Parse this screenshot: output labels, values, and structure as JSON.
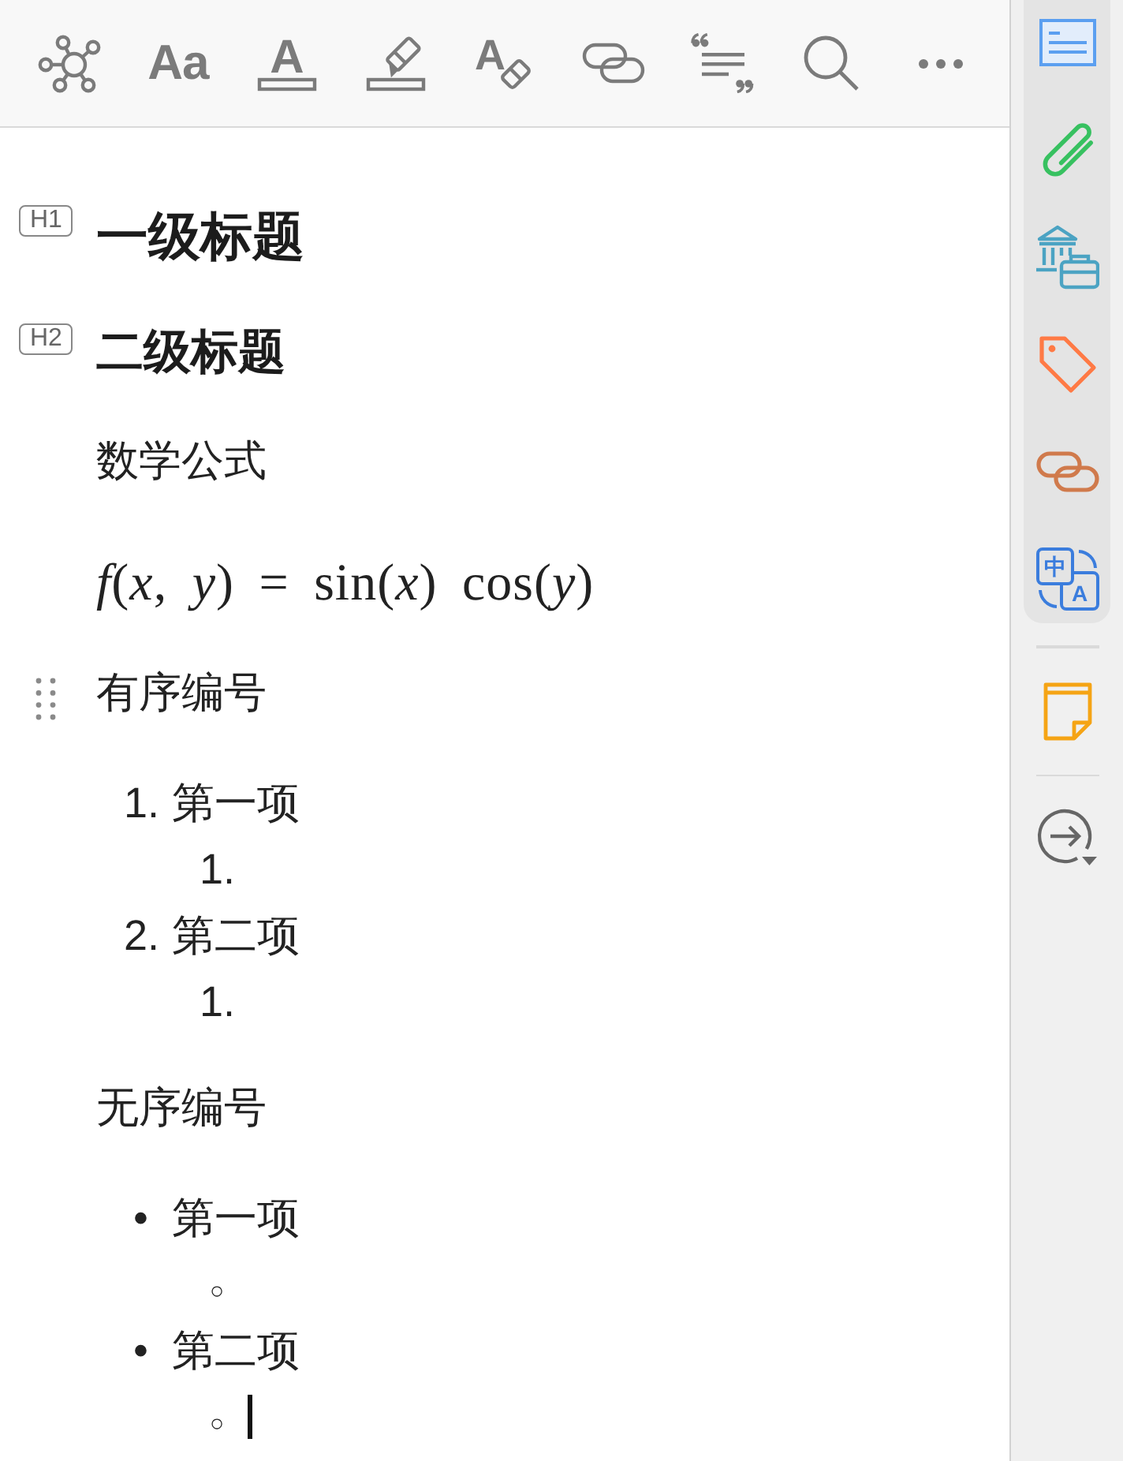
{
  "toolbar": {
    "tools": [
      {
        "kind": "graph"
      },
      {
        "kind": "font",
        "glyph": "Aa"
      },
      {
        "kind": "text-color",
        "glyph": "A"
      },
      {
        "kind": "highlight"
      },
      {
        "kind": "clear-format",
        "glyph": "A"
      },
      {
        "kind": "link"
      },
      {
        "kind": "quote"
      },
      {
        "kind": "search"
      },
      {
        "kind": "more"
      }
    ]
  },
  "document": {
    "blocks": [
      {
        "kind": "h1",
        "tag": "H1",
        "text": "一级标题"
      },
      {
        "kind": "h2",
        "tag": "H2",
        "text": "二级标题"
      },
      {
        "kind": "paragraph",
        "text": "数学公式",
        "hovered": false
      },
      {
        "kind": "formula",
        "text": "*f*(*x*, *y*) = sin(*x*) cos(*y*)"
      },
      {
        "kind": "paragraph",
        "text": "有序编号",
        "hovered": true
      },
      {
        "kind": "ordered-list",
        "items": [
          {
            "marker": "1.",
            "text": "第一项",
            "cursor": false,
            "children": [
              {
                "marker": "1.",
                "cursor": false
              }
            ]
          },
          {
            "marker": "2.",
            "text": "第二项",
            "cursor": false,
            "children": [
              {
                "marker": "1.",
                "cursor": false
              }
            ]
          }
        ]
      },
      {
        "kind": "paragraph",
        "text": "无序编号",
        "hovered": false
      },
      {
        "kind": "bullet-list",
        "items": [
          {
            "marker": "•",
            "text": "第一项",
            "cursor": false,
            "children": [
              {
                "marker": "○",
                "cursor": false
              }
            ]
          },
          {
            "marker": "•",
            "text": "第二项",
            "cursor": false,
            "children": [
              {
                "marker": "○",
                "cursor": true
              }
            ]
          }
        ]
      }
    ]
  },
  "sidebar": {
    "panel": [
      {
        "kind": "outline"
      },
      {
        "kind": "attachment"
      },
      {
        "kind": "library"
      },
      {
        "kind": "tag"
      },
      {
        "kind": "link"
      },
      {
        "kind": "translate",
        "glyphs": [
          "中",
          "A"
        ]
      }
    ],
    "extras": [
      {
        "kind": "note"
      },
      {
        "kind": "jump"
      }
    ]
  }
}
